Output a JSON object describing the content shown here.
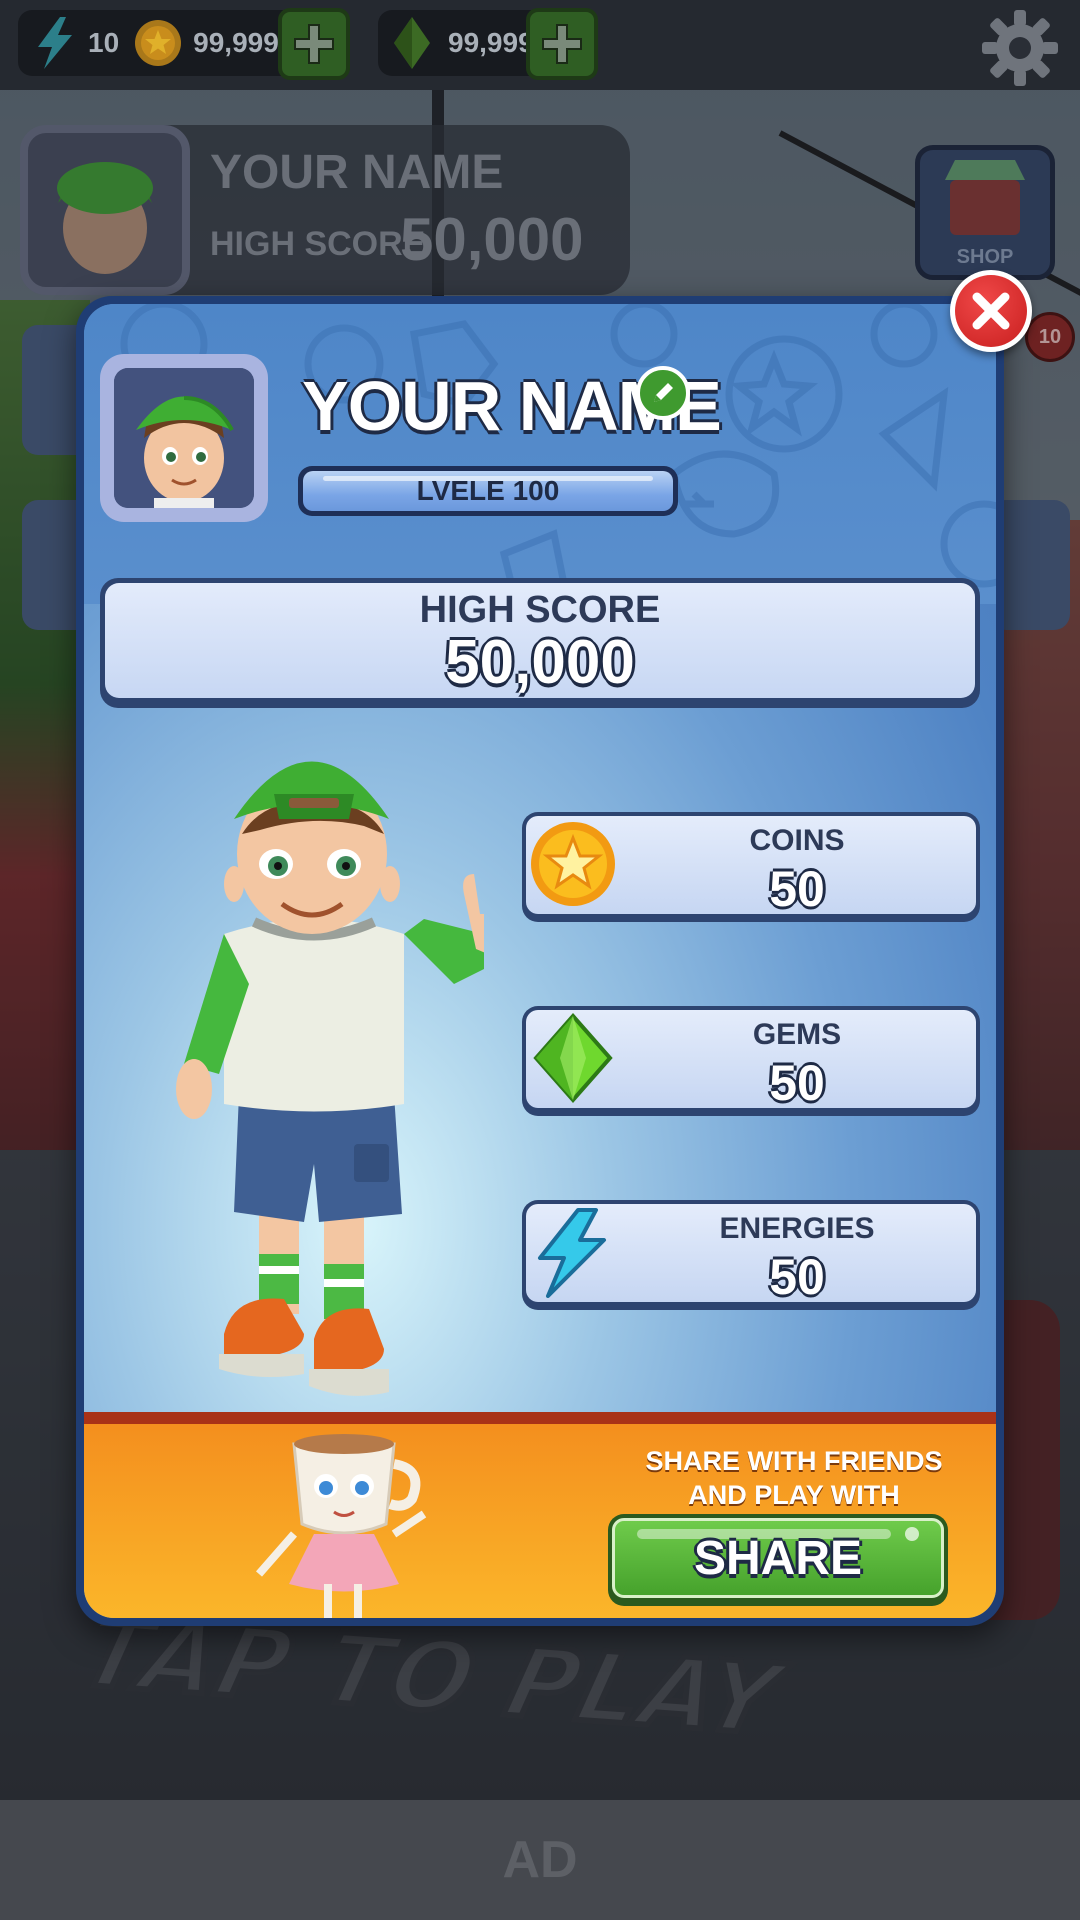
{
  "hud": {
    "energy": "10",
    "coins": "99,999",
    "gems": "99,999"
  },
  "background": {
    "profile_name": "YOUR NAME",
    "high_score_label": "HIGH SCORE",
    "high_score_value": "50,000",
    "shop_label": "SHOP",
    "badge_count": "10",
    "tap_to_play": "TAP TO PLAY"
  },
  "profile": {
    "name": "YOUR NAME",
    "level": "LVELE 100",
    "high_score_label": "HIGH SCORE",
    "high_score_value": "50,000"
  },
  "stats": [
    {
      "label": "COINS",
      "value": "50",
      "icon": "coin-icon"
    },
    {
      "label": "GEMS",
      "value": "50",
      "icon": "gem-icon"
    },
    {
      "label": "ENERGIES",
      "value": "50",
      "icon": "energy-icon"
    }
  ],
  "share": {
    "message_line1": "SHARE WITH FRIENDS",
    "message_line2": "AND PLAY WITH THEM!",
    "button_label": "SHARE"
  },
  "ad": {
    "label": "AD"
  },
  "colors": {
    "modal_border": "#1f3d74",
    "share_green": "#46a22c",
    "close_red": "#c81f1f",
    "share_orange": "#f48f1e"
  }
}
